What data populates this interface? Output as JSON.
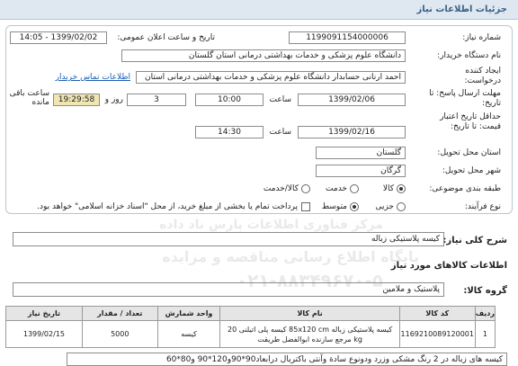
{
  "header": {
    "title": "جزئیات اطلاعات نیاز"
  },
  "form": {
    "need_number_label": "شماره نیاز:",
    "need_number": "1199091154000006",
    "announce_label": "تاریخ و ساعت اعلان عمومی:",
    "announce_value": "1399/02/02 - 14:05",
    "buyer_label": "نام دستگاه خریدار:",
    "buyer_value": "دانشگاه علوم پزشکی و خدمات بهداشتی درمانی استان گلستان",
    "creator_label": "ایجاد کننده درخواست:",
    "creator_value": "احمد ارنانی حسابدار دانشگاه علوم پزشکی و خدمات بهداشتی درمانی استان",
    "contact_link": "اطلاعات تماس خریدار",
    "reply_label": "مهلت ارسال پاسخ: تا تاریخ:",
    "reply_date": "1399/02/06",
    "time_label": "ساعت",
    "reply_time": "10:00",
    "days_value": "3",
    "days_label": "روز و",
    "remaining_time": "19:29:58",
    "remaining_label": "ساعت باقی مانده",
    "validity_label": "حداقل تاریخ اعتبار قیمت: تا تاریخ:",
    "validity_date": "1399/02/16",
    "validity_time": "14:30",
    "province_label": "استان محل تحویل:",
    "province_value": "گلستان",
    "city_label": "شهر محل تحویل:",
    "city_value": "گرگان",
    "category_label": "طبقه بندی موضوعی:",
    "category_options": [
      "کالا",
      "خدمت",
      "کالا/خدمت"
    ],
    "process_label": "نوع فرآیند:",
    "process_options": [
      "جزیی",
      "متوسط"
    ],
    "payment_text": "پرداخت تمام یا بخشی از مبلغ خرید، از محل \"اسناد خزانه اسلامی\" خواهد بود."
  },
  "description": {
    "label": "شرح کلی نیاز:",
    "value": "کیسه پلاستیکی زباله"
  },
  "goods_section": {
    "title": "اطلاعات کالاهای مورد نیاز",
    "group_label": "گروه کالا:",
    "group_value": "پلاستیک و ملامین"
  },
  "table": {
    "headers": [
      "ردیف",
      "کد کالا",
      "نام کالا",
      "واحد شمارش",
      "تعداد / مقدار",
      "تاریخ نیاز"
    ],
    "rows": [
      {
        "row": "1",
        "code": "1169210089120001",
        "name": "کیسه پلاستیکی زباله 85x120 cm کیسه پلی اتیلنی 20 kg مرجع سازنده ابوالفضل طریقت",
        "unit": "کیسه",
        "qty": "5000",
        "date": "1399/02/15"
      }
    ]
  },
  "footer_note": "کیسه های زباله در 2 رنگ مشکی وزرد ودونوع سادة وآنتی باکتریال درابعاد90*90و120*90 و80*60",
  "watermark": {
    "line1": "مرکز فناوری اطلاعات پارس ناد داده",
    "line2": "پایگاه اطلاع رسانی مناقصه و مزایده",
    "line3": "۰۲۱-۸۸۳۴۹۶۷۰-۵"
  }
}
